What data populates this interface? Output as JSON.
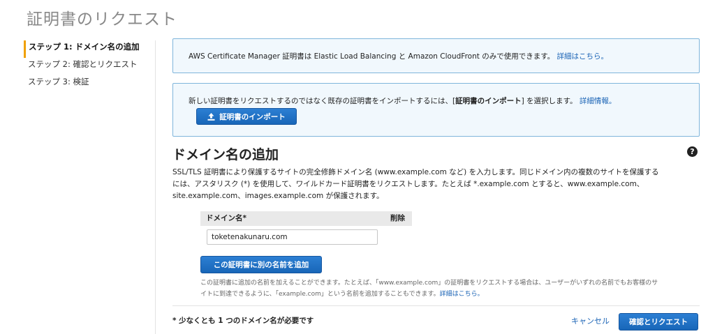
{
  "page_title": "証明書のリクエスト",
  "steps": [
    {
      "label": "ステップ 1: ドメイン名の追加",
      "active": true
    },
    {
      "label": "ステップ 2: 確認とリクエスト",
      "active": false
    },
    {
      "label": "ステップ 3: 検証",
      "active": false
    }
  ],
  "info1": {
    "text": "AWS Certificate Manager 証明書は Elastic Load Balancing と Amazon CloudFront のみで使用できます。",
    "link": "詳細はこちら。"
  },
  "info2": {
    "text": "新しい証明書をリクエストするのではなく既存の証明書をインポートするには、[",
    "bold": "証明書のインポート",
    "text_after": "] を選択します。",
    "link": "詳細情報。",
    "button": "証明書のインポート"
  },
  "section": {
    "title": "ドメイン名の追加",
    "help_icon": "question-circle-icon",
    "description_1": "SSL/TLS 証明書により保護するサイトの完全修飾ドメイン名 (www.example.com など) を入力します。同じドメイン内の複数のサイトを保護する",
    "description_2": "には、アスタリスク (*) を使用して、ワイルドカード証明書をリクエストします。たとえば *.example.com とすると、www.example.com、",
    "description_3": "site.example.com、images.example.com が保護されます。"
  },
  "table": {
    "col_domain": "ドメイン名*",
    "col_delete": "削除",
    "domain_value": "toketenakunaru.com"
  },
  "add_button": "この証明書に別の名前を追加",
  "note": {
    "text_1": "この証明書に追加の名前を加えることができます。たとえば、「www.example.com」の証明書をリクエストする場合は、ユーザーがいずれの名前でもお客様のサ",
    "text_2": "イトに到達できるように、「example.com」という名前を追加することもできます。",
    "link": "詳細はこちら。"
  },
  "footer": {
    "required": "* 少なくとも 1 つのドメイン名が必要です",
    "cancel": "キャンセル",
    "confirm": "確認とリクエスト"
  },
  "colors": {
    "accent": "#1866b8",
    "link": "#1a63b5",
    "step_marker": "#f0a000",
    "info_bg": "#f1f8fd",
    "info_border": "#7fb5db"
  }
}
